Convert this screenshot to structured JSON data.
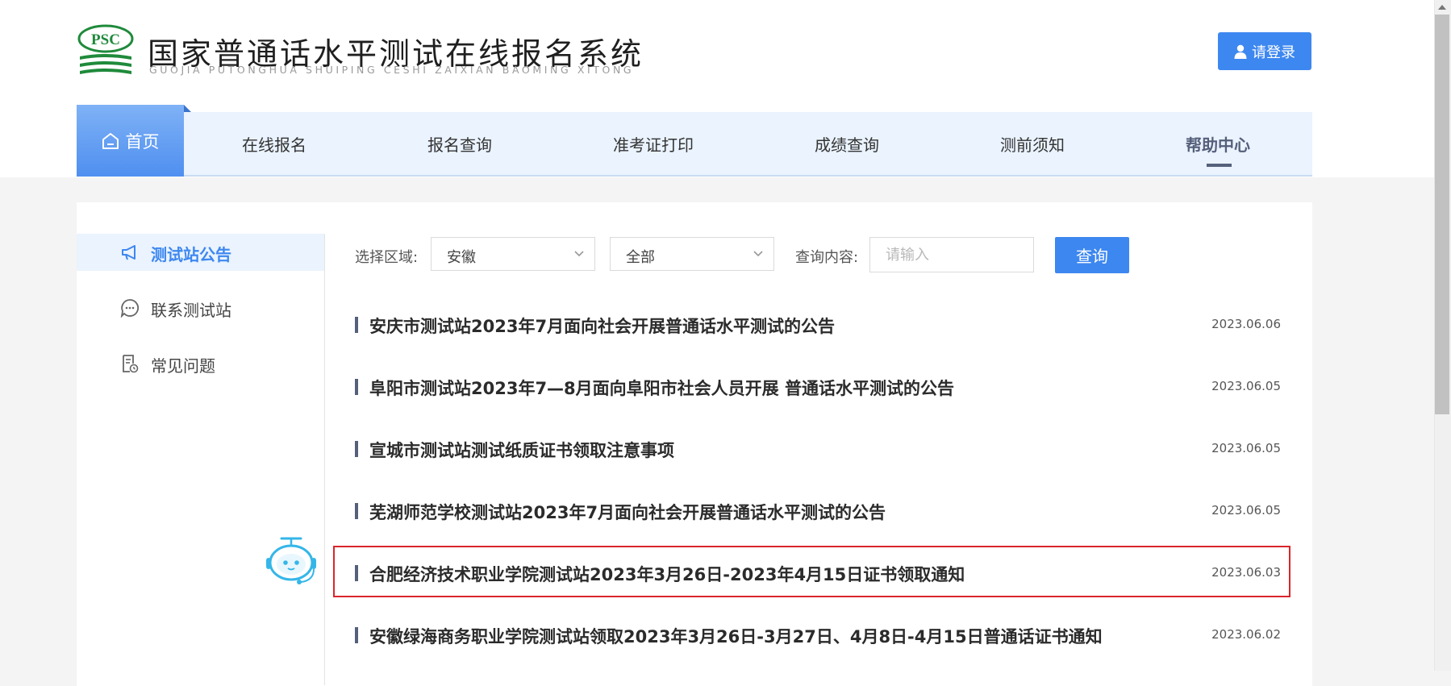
{
  "header": {
    "logo_text": "PSC",
    "title": "国家普通话水平测试在线报名系统",
    "pinyin": "GUOJIA PUTONGHUA SHUIPING CESHI ZAIXIAN BAOMING XITONG",
    "login_label": "请登录"
  },
  "nav": {
    "home": "首页",
    "items": [
      {
        "label": "在线报名"
      },
      {
        "label": "报名查询"
      },
      {
        "label": "准考证打印"
      },
      {
        "label": "成绩查询"
      },
      {
        "label": "测前须知"
      },
      {
        "label": "帮助中心",
        "active": true
      }
    ]
  },
  "sidebar": {
    "items": [
      {
        "label": "测试站公告",
        "icon": "megaphone-icon",
        "active": true
      },
      {
        "label": "联系测试站",
        "icon": "chat-icon"
      },
      {
        "label": "常见问题",
        "icon": "document-clock-icon"
      }
    ]
  },
  "filters": {
    "region_label": "选择区域:",
    "province": "安徽",
    "city": "全部",
    "query_label": "查询内容:",
    "query_placeholder": "请输入",
    "query_button": "查询"
  },
  "notices": [
    {
      "title": "安庆市测试站2023年7月面向社会开展普通话水平测试的公告",
      "date": "2023.06.06"
    },
    {
      "title": "阜阳市测试站2023年7—8月面向阜阳市社会人员开展 普通话水平测试的公告",
      "date": "2023.06.05"
    },
    {
      "title": "宣城市测试站测试纸质证书领取注意事项",
      "date": "2023.06.05"
    },
    {
      "title": "芜湖师范学校测试站2023年7月面向社会开展普通话水平测试的公告",
      "date": "2023.06.05"
    },
    {
      "title": "合肥经济技术职业学院测试站2023年3月26日-2023年4月15日证书领取通知",
      "date": "2023.06.03",
      "highlighted": true
    },
    {
      "title": "安徽绿海商务职业学院测试站领取2023年3月26日-3月27日、4月8日-4月15日普通话证书通知",
      "date": "2023.06.02"
    }
  ],
  "colors": {
    "accent": "#3d87f0",
    "nav_bg": "#eaf3fe",
    "logo_green": "#1f8a3b",
    "highlight_border": "#d9262b"
  }
}
